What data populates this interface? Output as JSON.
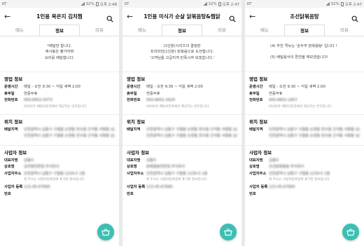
{
  "panels": [
    {
      "status": {
        "carrier": "KT",
        "battery": "32%",
        "time": "오후 2:48"
      },
      "title": "1인용 묵은지 김치찜",
      "tabs": [
        "메뉴",
        "정보",
        "리뷰"
      ],
      "notice": [
        "*배달만 합니다.",
        "재사용은 불가하며",
        "요리를 배달합니다."
      ],
      "business": {
        "title": "영업 정보",
        "hours_label": "운영시간",
        "hours": "매일 - 오전 9:30 ~ 익일 새벽 2:00",
        "holiday_label": "휴무일",
        "holiday": "연중무휴",
        "phone_label": "전화번호",
        "phone": "050-6652-5573",
        "phone_note": "050번호 배달의민족에서 제공하는 번호입니다."
      },
      "location": {
        "title": "위치 정보",
        "area_label": "배달지역",
        "area": "인천광역시 남동구 구월동 논현동 만수동 간석동 서창동 남촌동 도림동"
      },
      "owner": {
        "title": "사업자 정보",
        "rep_label": "대표자명",
        "rep": "김철수",
        "name_label": "상호명",
        "name": "김치찜전문점 주식회사",
        "addr_label": "사업자주소",
        "addr": "인천광역시 남동구 구월동 1234-5 1층",
        "addr_note": "위 주소는 사업자등록증에 표기된 정보입니다.",
        "reg_label": "사업자 등록번호",
        "reg": "123-45-67890"
      }
    },
    {
      "status": {
        "carrier": "KT",
        "battery": "32%",
        "time": "오후 2:47"
      },
      "title": "1인용 미식가 순살 닭볶음탕&찜닭",
      "tabs": [
        "메뉴",
        "정보",
        "리뷰"
      ],
      "notice": [
        "(1인분)시리즈의 결정판",
        "프리미엄(1인분) 닭볶음으로 도전합니다.",
        "'고객님을 고급지게 만족시켜 보겠습니다.'"
      ],
      "business": {
        "title": "영업 정보",
        "hours_label": "운영시간",
        "hours": "매일 - 오전 9:30 ~ 익일 새벽 2:00",
        "holiday_label": "휴무일",
        "holiday": "연중무휴",
        "phone_label": "전화번호",
        "phone": "050-6652-1629",
        "phone_note": "050번호 배달의민족에서 제공하는 번호입니다."
      },
      "location": {
        "title": "위치 정보",
        "area_label": "배달지역",
        "area": "인천광역시 남동구 구월동 논현동 만수동 간석동 서창동 남촌동 도림동"
      },
      "owner": {
        "title": "사업자 정보",
        "rep_label": "대표자명",
        "rep": "김철수",
        "name_label": "상호명",
        "name": "닭볶음탕전문점 주식회사",
        "addr_label": "사업자주소",
        "addr": "인천광역시 남동구 구월동 1234-5 1층",
        "addr_note": "위 주소는 사업자등록증에 표기된 정보입니다.",
        "reg_label": "사업자 등록번호",
        "reg": "123-45-67890"
      }
    },
    {
      "status": {
        "carrier": "KT",
        "battery": "32%",
        "time": "오후 2:47"
      },
      "title": "조선닭볶음탕",
      "tabs": [
        "메뉴",
        "정보",
        "리뷰"
      ],
      "notice": [
        "(4) 추천 쿡뉴는 '순두부 닭볶음탕' 입니다 !",
        "",
        "(5) 배달음식의 편견을 깨보겠습니다!"
      ],
      "business": {
        "title": "영업 정보",
        "hours_label": "운영시간",
        "hours": "매일 - 오전 9:30 ~ 익일 새벽 2:00",
        "holiday_label": "휴무일",
        "holiday": "연중무휴",
        "phone_label": "전화번호",
        "phone": "050-6652-1657",
        "phone_note": "050번호 배달의민족에서 제공하는 번호입니다."
      },
      "location": {
        "title": "위치 정보",
        "area_label": "배달지역",
        "area": "인천광역시 남동구 구월동 논현동 만수동 간석동 서창동 남촌동 도림동"
      },
      "owner": {
        "title": "사업자 정보",
        "rep_label": "대표자명",
        "rep": "김철수",
        "name_label": "상호명",
        "name": "조선닭볶음탕 주식회사",
        "addr_label": "사업자주소",
        "addr": "인천광역시 남동구 구월동 1234-5 1층",
        "addr_note": "위 주소는 사업자등록증에 표기된 정보입니다.",
        "reg_label": "사업자 등록번호",
        "reg": "123-45-67890"
      }
    }
  ],
  "colors": {
    "accent": "#3cbfb4",
    "phone": "#33aabb"
  },
  "icons": {
    "back": "back-arrow-icon",
    "search": "search-icon",
    "fab": "basket-icon"
  }
}
